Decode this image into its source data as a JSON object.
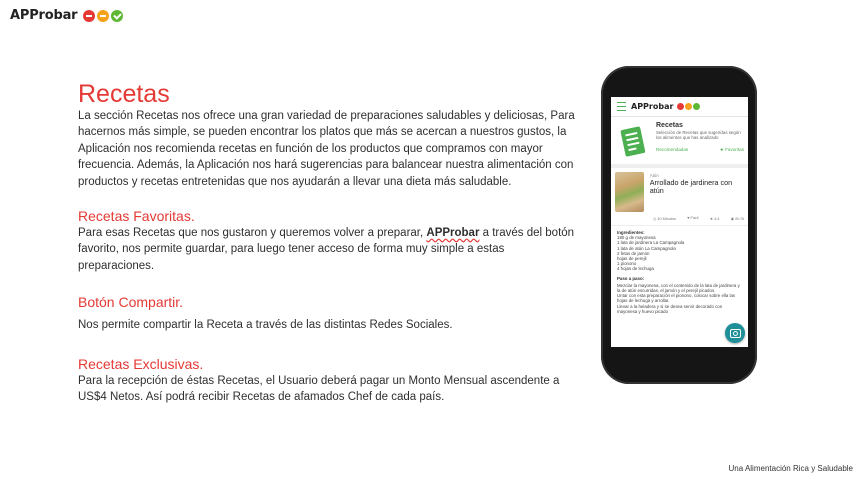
{
  "brand": {
    "logo_text": "APProbar",
    "dot_colors": [
      "#e53935",
      "#f7a21b",
      "#5cb833"
    ]
  },
  "main": {
    "title": "Recetas",
    "intro": "La sección Recetas nos ofrece una gran variedad de preparaciones saludables y deliciosas, Para hacernos más simple, se pueden encontrar los platos que más se acercan a nuestros gustos, la Aplicación nos recomienda recetas en función de los productos que compramos con mayor frecuencia. Además, la Aplicación nos hará sugerencias para balancear nuestra alimentación con productos y recetas entretenidas que nos ayudarán a llevar una dieta más saludable.",
    "favoritas": {
      "title": "Recetas Favoritas.",
      "text_before": "Para esas Recetas que nos gustaron y queremos volver a preparar, ",
      "brand": "APProbar",
      "text_after": " a través del botón favorito, nos permite guardar, para luego tener acceso de forma muy simple a estas preparaciones."
    },
    "compartir": {
      "title": "Botón Compartir.",
      "text": "Nos permite compartir la Receta a través de las distintas Redes Sociales."
    },
    "exclusivas": {
      "title": "Recetas Exclusivas.",
      "text": "Para la recepción de éstas Recetas, el Usuario deberá pagar un Monto Mensual ascendente a US$4 Netos. Así podrá recibir Recetas de afamados Chef de cada país."
    }
  },
  "phone": {
    "app_logo": "APProbar",
    "header": {
      "title": "Recetas",
      "description": "Selección de Recetas que sugerídas según los alimentos que has analizado",
      "link_recommended": "Recomendadas",
      "link_favorites": "Favoritas"
    },
    "recipe": {
      "category": "Atún",
      "title": "Arrollado de jardinera con atún",
      "time": "40 Minutos",
      "level": "Fácil",
      "rating": "4.4",
      "servings": "2h St"
    },
    "ingredients_title": "Ingredientes:",
    "ingredients": [
      "180 g de mayonesa",
      "1 lata de jardinera La Campagnola",
      "1 lata de atún La Campagnola",
      "2 fetas de jamón",
      "hojas de perejil",
      "1 pionono",
      "4 hojas de lechuga"
    ],
    "steps_title": "Paso a paso:",
    "steps": [
      "Mezclar la mayonesa, con el contenido de la lata de jardinera y la de atún escurridas, el jamón y el perejil picados.",
      "Untar con esta preparación el pionono, colocar sobre ella las hojas de lechuga y arrollar.",
      "Llevar a la heladera y si se desea servir decorado con mayonesa y huevo picado"
    ]
  },
  "footer": {
    "tagline": "Una Alimentación Rica y Saludable"
  },
  "colors": {
    "accent_red": "#e53935",
    "app_green": "#4caf50",
    "fab_teal": "#1e8f99"
  }
}
